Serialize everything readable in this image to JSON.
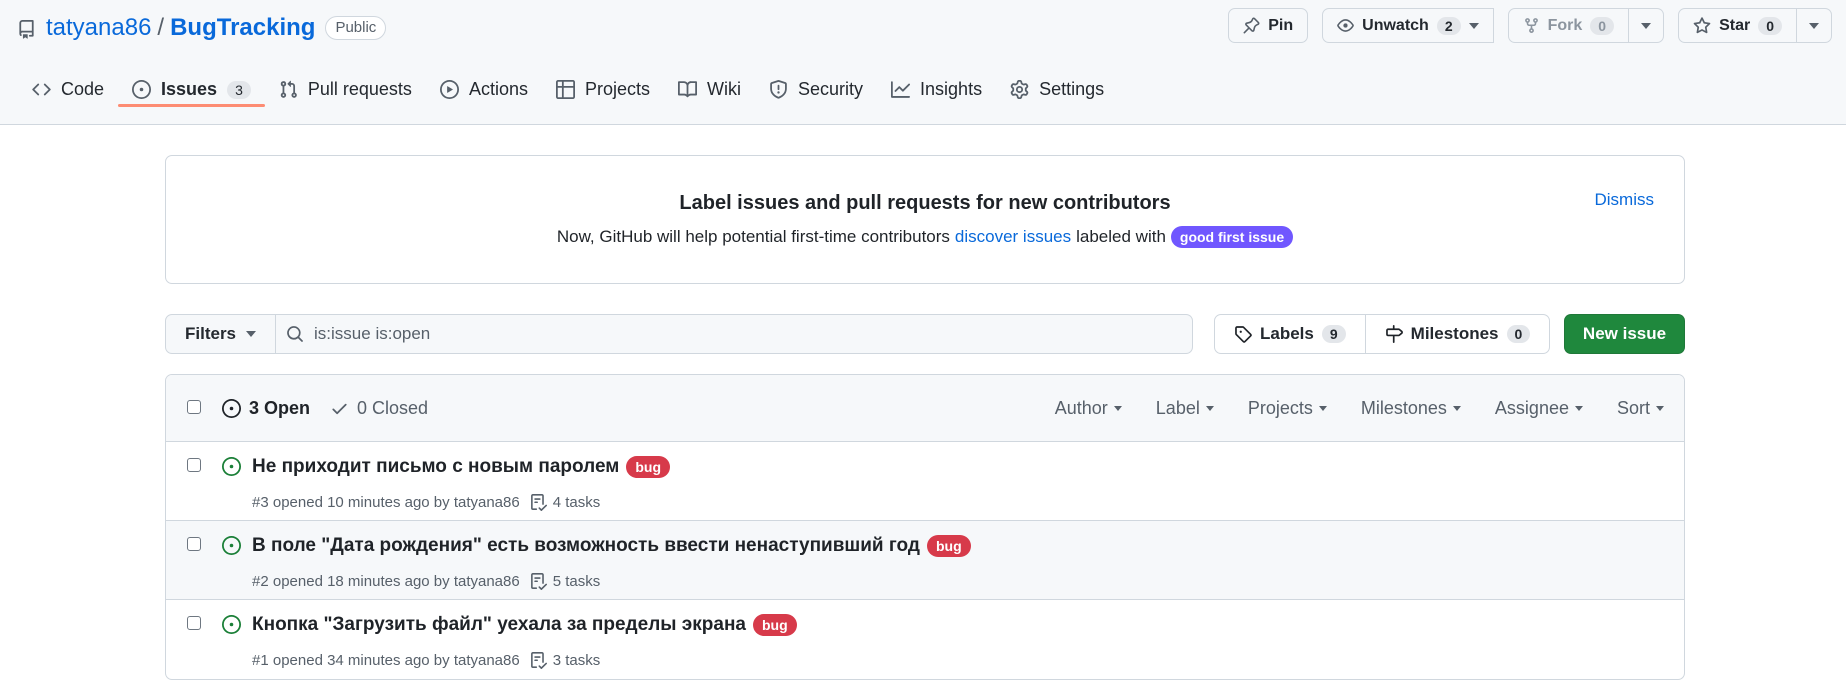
{
  "repo": {
    "owner": "tatyana86",
    "separator": "/",
    "name": "BugTracking",
    "visibility": "Public"
  },
  "header_actions": {
    "pin": {
      "label": "Pin"
    },
    "unwatch": {
      "label": "Unwatch",
      "count": "2"
    },
    "fork": {
      "label": "Fork",
      "count": "0"
    },
    "star": {
      "label": "Star",
      "count": "0"
    }
  },
  "tabs": [
    {
      "label": "Code",
      "icon": "code-icon"
    },
    {
      "label": "Issues",
      "icon": "issue-opened-icon",
      "count": "3",
      "selected": true
    },
    {
      "label": "Pull requests",
      "icon": "git-pull-request-icon"
    },
    {
      "label": "Actions",
      "icon": "play-icon"
    },
    {
      "label": "Projects",
      "icon": "table-icon"
    },
    {
      "label": "Wiki",
      "icon": "book-icon"
    },
    {
      "label": "Security",
      "icon": "shield-icon"
    },
    {
      "label": "Insights",
      "icon": "graph-icon"
    },
    {
      "label": "Settings",
      "icon": "gear-icon"
    }
  ],
  "banner": {
    "title": "Label issues and pull requests for new contributors",
    "text_before": "Now, GitHub will help potential first-time contributors",
    "link": "discover issues",
    "text_after": "labeled with",
    "badge": "good first issue",
    "dismiss": "Dismiss"
  },
  "filters": {
    "button": "Filters",
    "search_value": "is:issue is:open"
  },
  "labels_btn": {
    "label": "Labels",
    "count": "9"
  },
  "milestones_btn": {
    "label": "Milestones",
    "count": "0"
  },
  "new_issue": "New issue",
  "list": {
    "open": "3 Open",
    "closed": "0 Closed",
    "sorters": [
      "Author",
      "Label",
      "Projects",
      "Milestones",
      "Assignee",
      "Sort"
    ]
  },
  "issues": [
    {
      "title": "Не приходит письмо с новым паролем",
      "label": "bug",
      "meta": "#3 opened 10 minutes ago by tatyana86",
      "tasks": "4 tasks"
    },
    {
      "title": "В поле \"Дата рождения\" есть возможность ввести ненаступивший год",
      "label": "bug",
      "meta": "#2 opened 18 minutes ago by tatyana86",
      "tasks": "5 tasks"
    },
    {
      "title": "Кнопка \"Загрузить файл\" уехала за пределы экрана",
      "label": "bug",
      "meta": "#1 opened 34 minutes ago by tatyana86",
      "tasks": "3 tasks"
    }
  ],
  "colors": {
    "link": "#0969da",
    "open_green": "#1a7f37",
    "new_issue_green": "#1f883d",
    "bug_red": "#d73a4a",
    "good_first_issue_purple": "#7057ff",
    "tab_underline": "#fd8c73"
  }
}
